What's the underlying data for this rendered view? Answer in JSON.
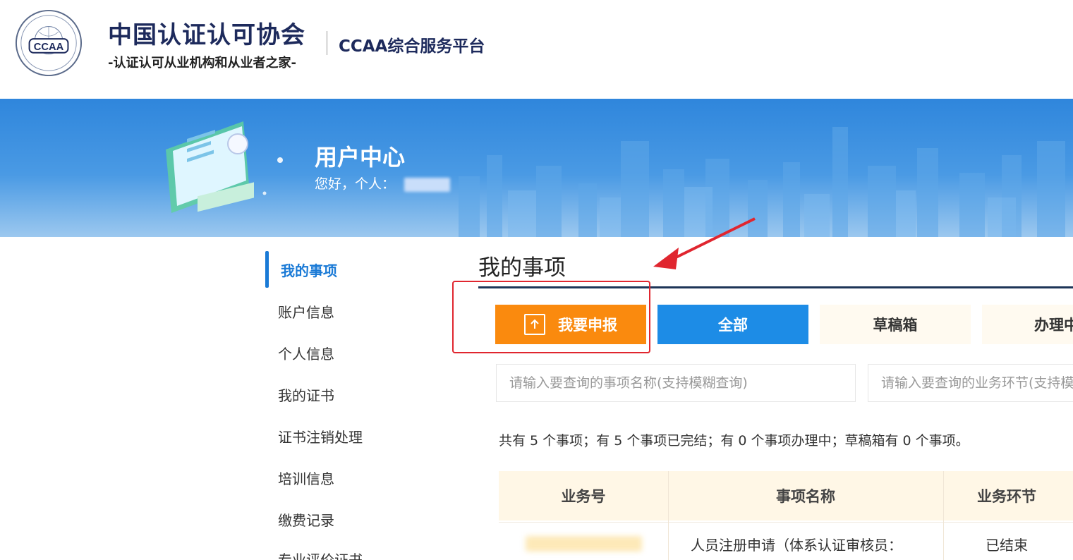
{
  "header": {
    "org_name": "中国认证认可协会",
    "org_slogan": "-认证认可从业机构和从业者之家-",
    "platform_name": "CCAA综合服务平台",
    "logo_text": "CCAA"
  },
  "banner": {
    "title": "用户中心",
    "greeting": "您好，个人："
  },
  "sidebar": {
    "items": [
      {
        "label": "我的事项",
        "active": true
      },
      {
        "label": "账户信息"
      },
      {
        "label": "个人信息"
      },
      {
        "label": "我的证书"
      },
      {
        "label": "证书注销处理"
      },
      {
        "label": "培训信息"
      },
      {
        "label": "缴费记录"
      },
      {
        "label": "专业评价证书"
      }
    ]
  },
  "main": {
    "title": "我的事项",
    "report_button": "我要申报",
    "tabs": [
      {
        "label": "全部",
        "active": true
      },
      {
        "label": "草稿箱"
      },
      {
        "label": "办理中"
      }
    ],
    "search": {
      "name_placeholder": "请输入要查询的事项名称(支持模糊查询)",
      "stage_placeholder": "请输入要查询的业务环节(支持模糊查询)"
    },
    "summary": "共有 5 个事项；有 5 个事项已完结；有 0 个事项办理中；草稿箱有 0 个事项。",
    "table": {
      "headers": [
        "业务号",
        "事项名称",
        "业务环节"
      ],
      "rows": [
        {
          "name": "人员注册申请（体系认证审核员：",
          "stage": "已结束"
        }
      ]
    }
  },
  "colors": {
    "primary_blue": "#1d8ce6",
    "orange": "#fa8a0e",
    "annotation_red": "#e0262f",
    "dark_navy": "#1d2a5c"
  }
}
